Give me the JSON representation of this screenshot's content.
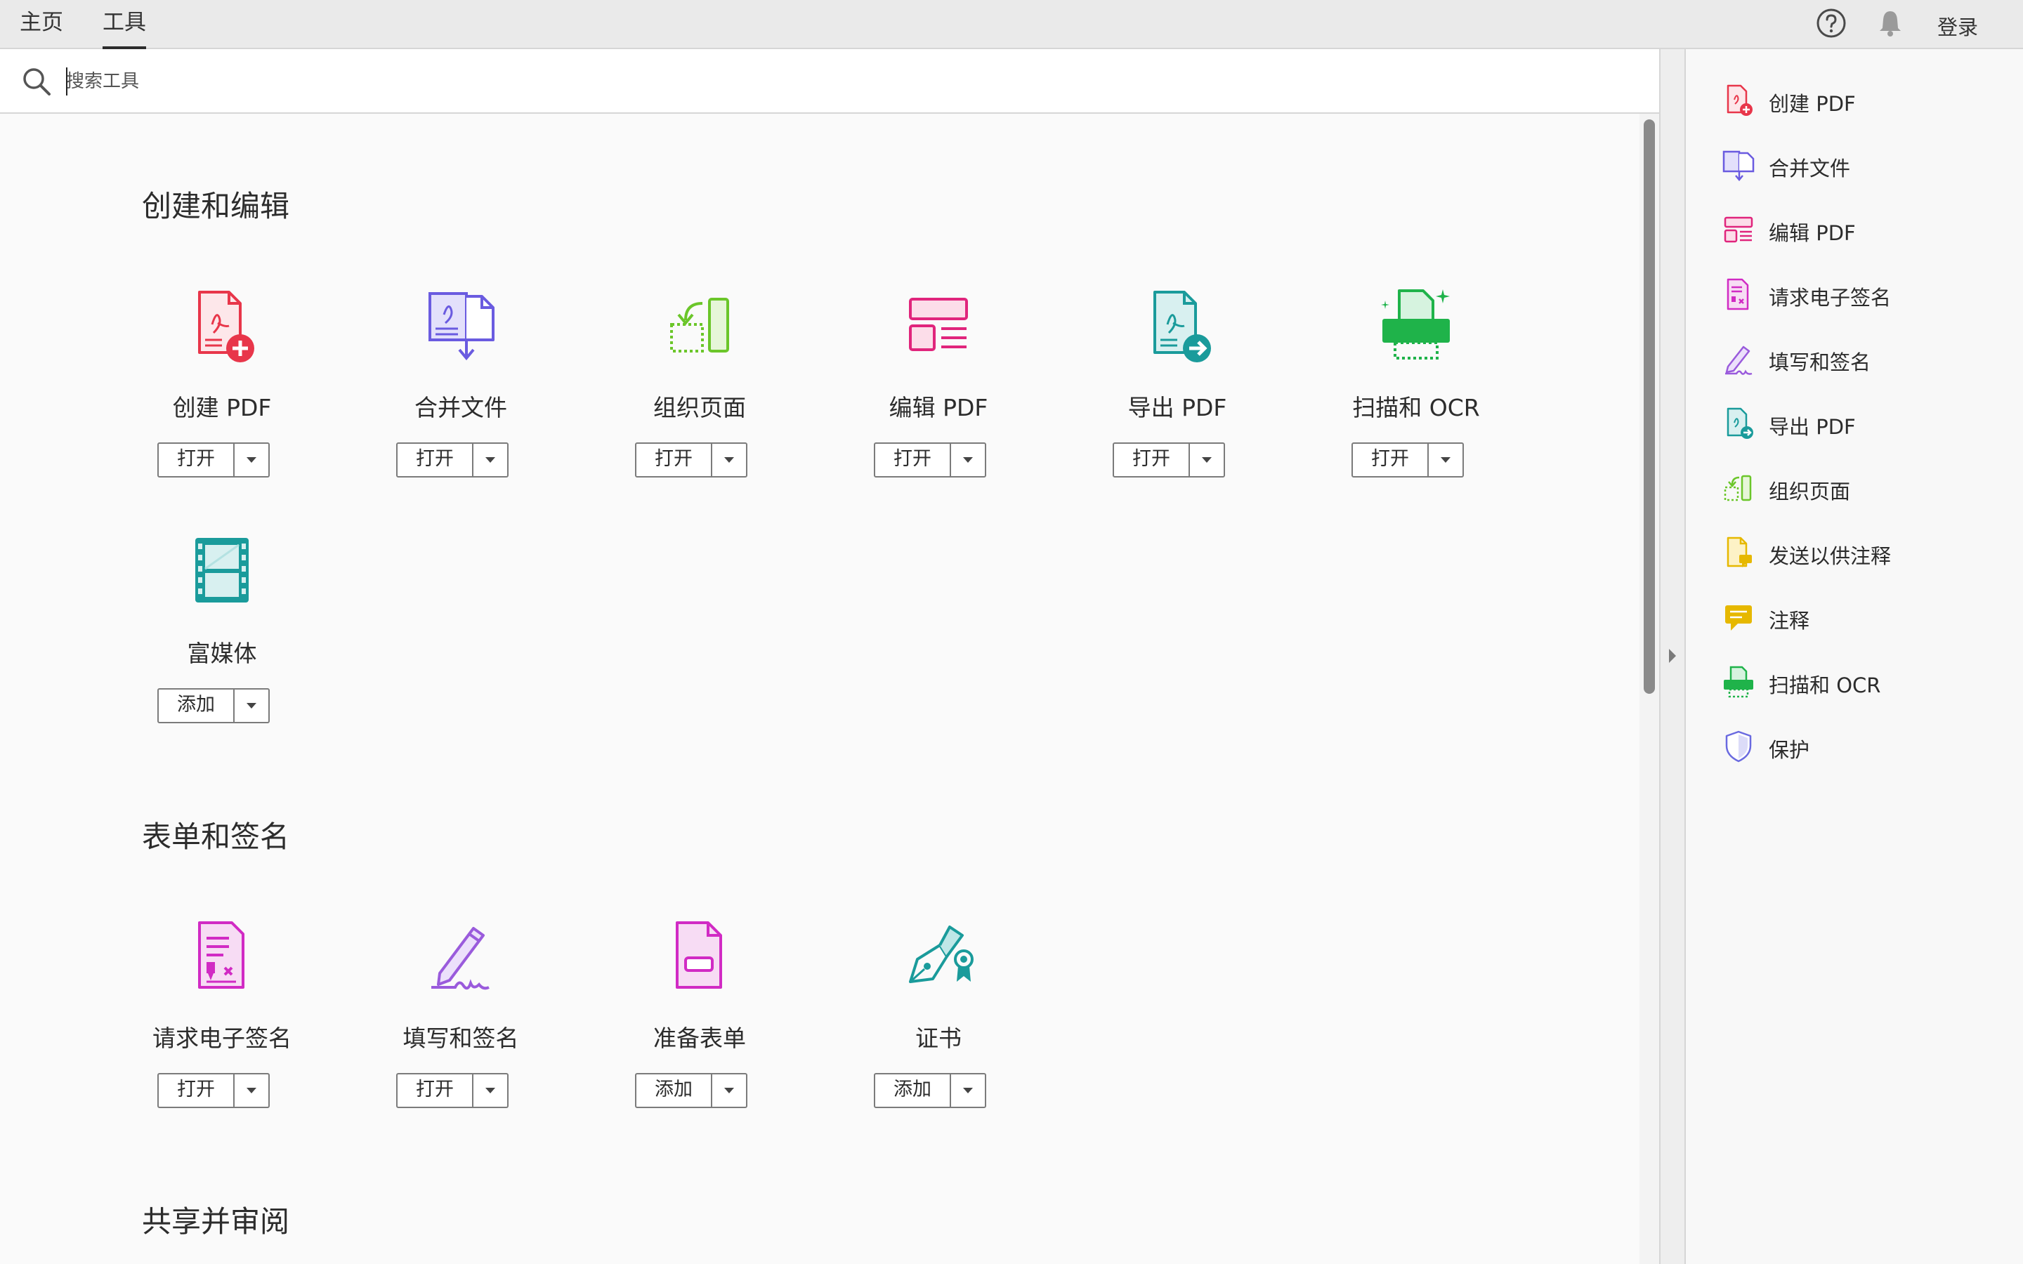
{
  "topbar": {
    "tabs": [
      {
        "label": "主页",
        "active": false
      },
      {
        "label": "工具",
        "active": true
      }
    ],
    "help_icon": "help-circle-icon",
    "bell_icon": "bell-icon",
    "login_label": "登录"
  },
  "search": {
    "placeholder": "搜索工具",
    "value": ""
  },
  "sections": [
    {
      "title": "创建和编辑",
      "tools": [
        {
          "label": "创建 PDF",
          "button": "打开",
          "icon": "create-pdf-icon",
          "color": "#e8364a"
        },
        {
          "label": "合并文件",
          "button": "打开",
          "icon": "combine-files-icon",
          "color": "#6a5be0"
        },
        {
          "label": "组织页面",
          "button": "打开",
          "icon": "organize-pages-icon",
          "color": "#6bc62a"
        },
        {
          "label": "编辑 PDF",
          "button": "打开",
          "icon": "edit-pdf-icon",
          "color": "#e0257c"
        },
        {
          "label": "导出 PDF",
          "button": "打开",
          "icon": "export-pdf-icon",
          "color": "#1a9b9b"
        },
        {
          "label": "扫描和 OCR",
          "button": "打开",
          "icon": "scan-ocr-icon",
          "color": "#1fb34a"
        },
        {
          "label": "富媒体",
          "button": "添加",
          "icon": "rich-media-icon",
          "color": "#1a9b9b"
        }
      ]
    },
    {
      "title": "表单和签名",
      "tools": [
        {
          "label": "请求电子签名",
          "button": "打开",
          "icon": "request-esign-icon",
          "color": "#d12bc4"
        },
        {
          "label": "填写和签名",
          "button": "打开",
          "icon": "fill-sign-icon",
          "color": "#9a5bdc"
        },
        {
          "label": "准备表单",
          "button": "添加",
          "icon": "prepare-form-icon",
          "color": "#d12bc4"
        },
        {
          "label": "证书",
          "button": "添加",
          "icon": "certificate-icon",
          "color": "#1a9b9b"
        }
      ]
    },
    {
      "title": "共享并审阅",
      "tools": []
    }
  ],
  "right_panel": {
    "items": [
      {
        "label": "创建 PDF",
        "icon": "create-pdf-icon"
      },
      {
        "label": "合并文件",
        "icon": "combine-files-icon"
      },
      {
        "label": "编辑 PDF",
        "icon": "edit-pdf-icon"
      },
      {
        "label": "请求电子签名",
        "icon": "request-esign-icon"
      },
      {
        "label": "填写和签名",
        "icon": "fill-sign-icon"
      },
      {
        "label": "导出 PDF",
        "icon": "export-pdf-icon"
      },
      {
        "label": "组织页面",
        "icon": "organize-pages-icon"
      },
      {
        "label": "发送以供注释",
        "icon": "send-for-comment-icon"
      },
      {
        "label": "注释",
        "icon": "comment-icon"
      },
      {
        "label": "扫描和 OCR",
        "icon": "scan-ocr-icon"
      },
      {
        "label": "保护",
        "icon": "protect-icon"
      }
    ]
  },
  "colors": {
    "red": "#e8364a",
    "purple": "#6a5be0",
    "green": "#6bc62a",
    "pink": "#e0257c",
    "teal": "#1a9b9b",
    "scan_green": "#1fb34a",
    "magenta": "#d12bc4",
    "violet": "#9a5bdc",
    "yellow": "#e6b800",
    "shield": "#6a6ae0"
  }
}
